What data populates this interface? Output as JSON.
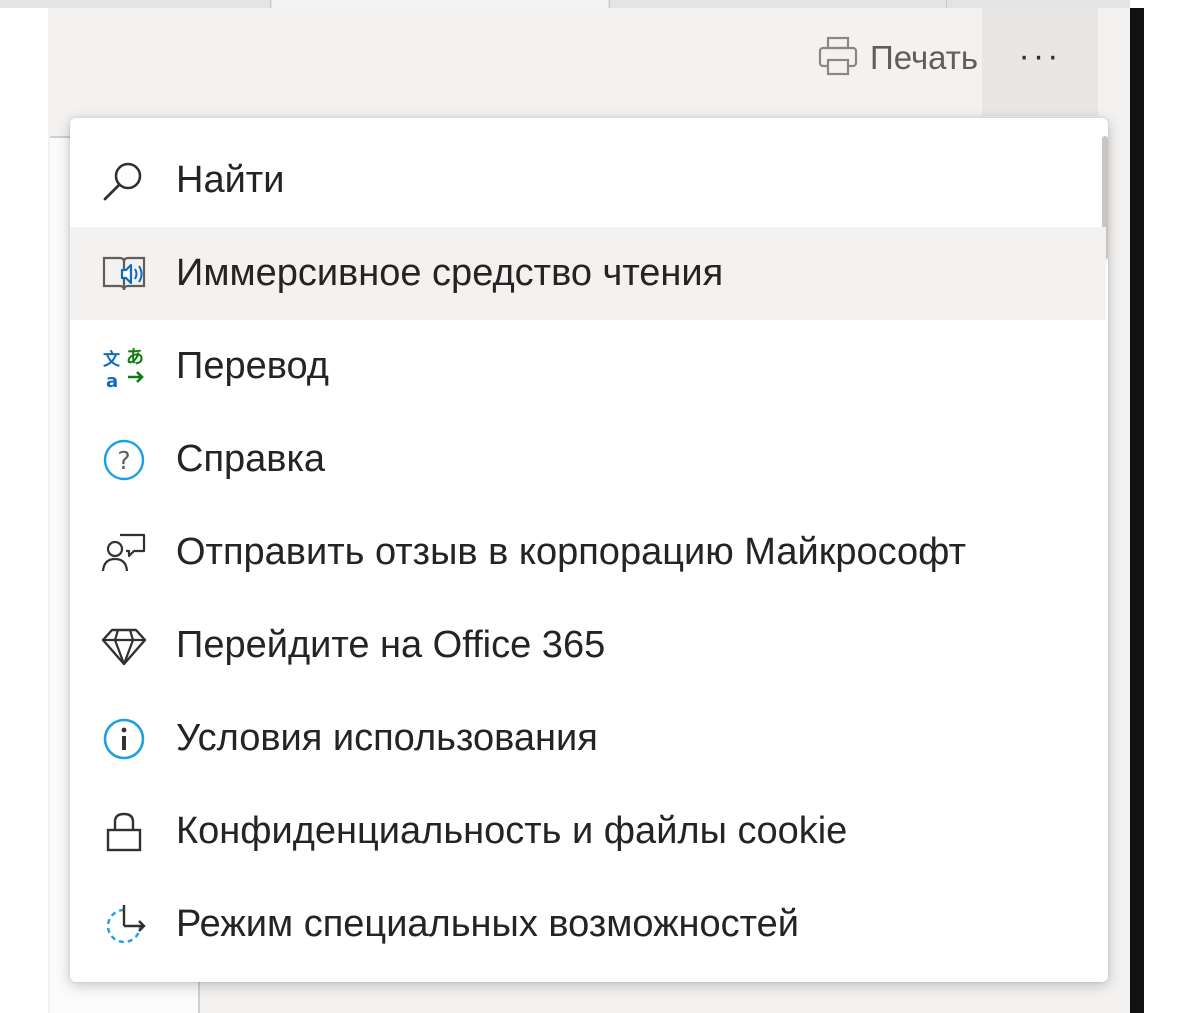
{
  "toolbar": {
    "print_label": "Печать",
    "more_label": "···"
  },
  "menu": {
    "items": [
      {
        "label": "Найти",
        "icon": "search-icon"
      },
      {
        "label": "Иммерсивное средство чтения",
        "icon": "immersive-reader-icon"
      },
      {
        "label": "Перевод",
        "icon": "translate-icon"
      },
      {
        "label": "Справка",
        "icon": "help-icon"
      },
      {
        "label": "Отправить отзыв в корпорацию Майкрософт",
        "icon": "feedback-icon"
      },
      {
        "label": "Перейдите на Office 365",
        "icon": "diamond-icon"
      },
      {
        "label": "Условия использования",
        "icon": "info-icon"
      },
      {
        "label": "Конфиденциальность и файлы cookie",
        "icon": "lock-icon"
      },
      {
        "label": "Режим специальных возможностей",
        "icon": "accessibility-mode-icon"
      }
    ],
    "hovered_index": 1
  },
  "colors": {
    "accent_blue": "#0f6cbd",
    "teal": "#1ba1e2",
    "translate_green": "#107c10",
    "text": "#252423",
    "hover": "#f3f2f1"
  }
}
